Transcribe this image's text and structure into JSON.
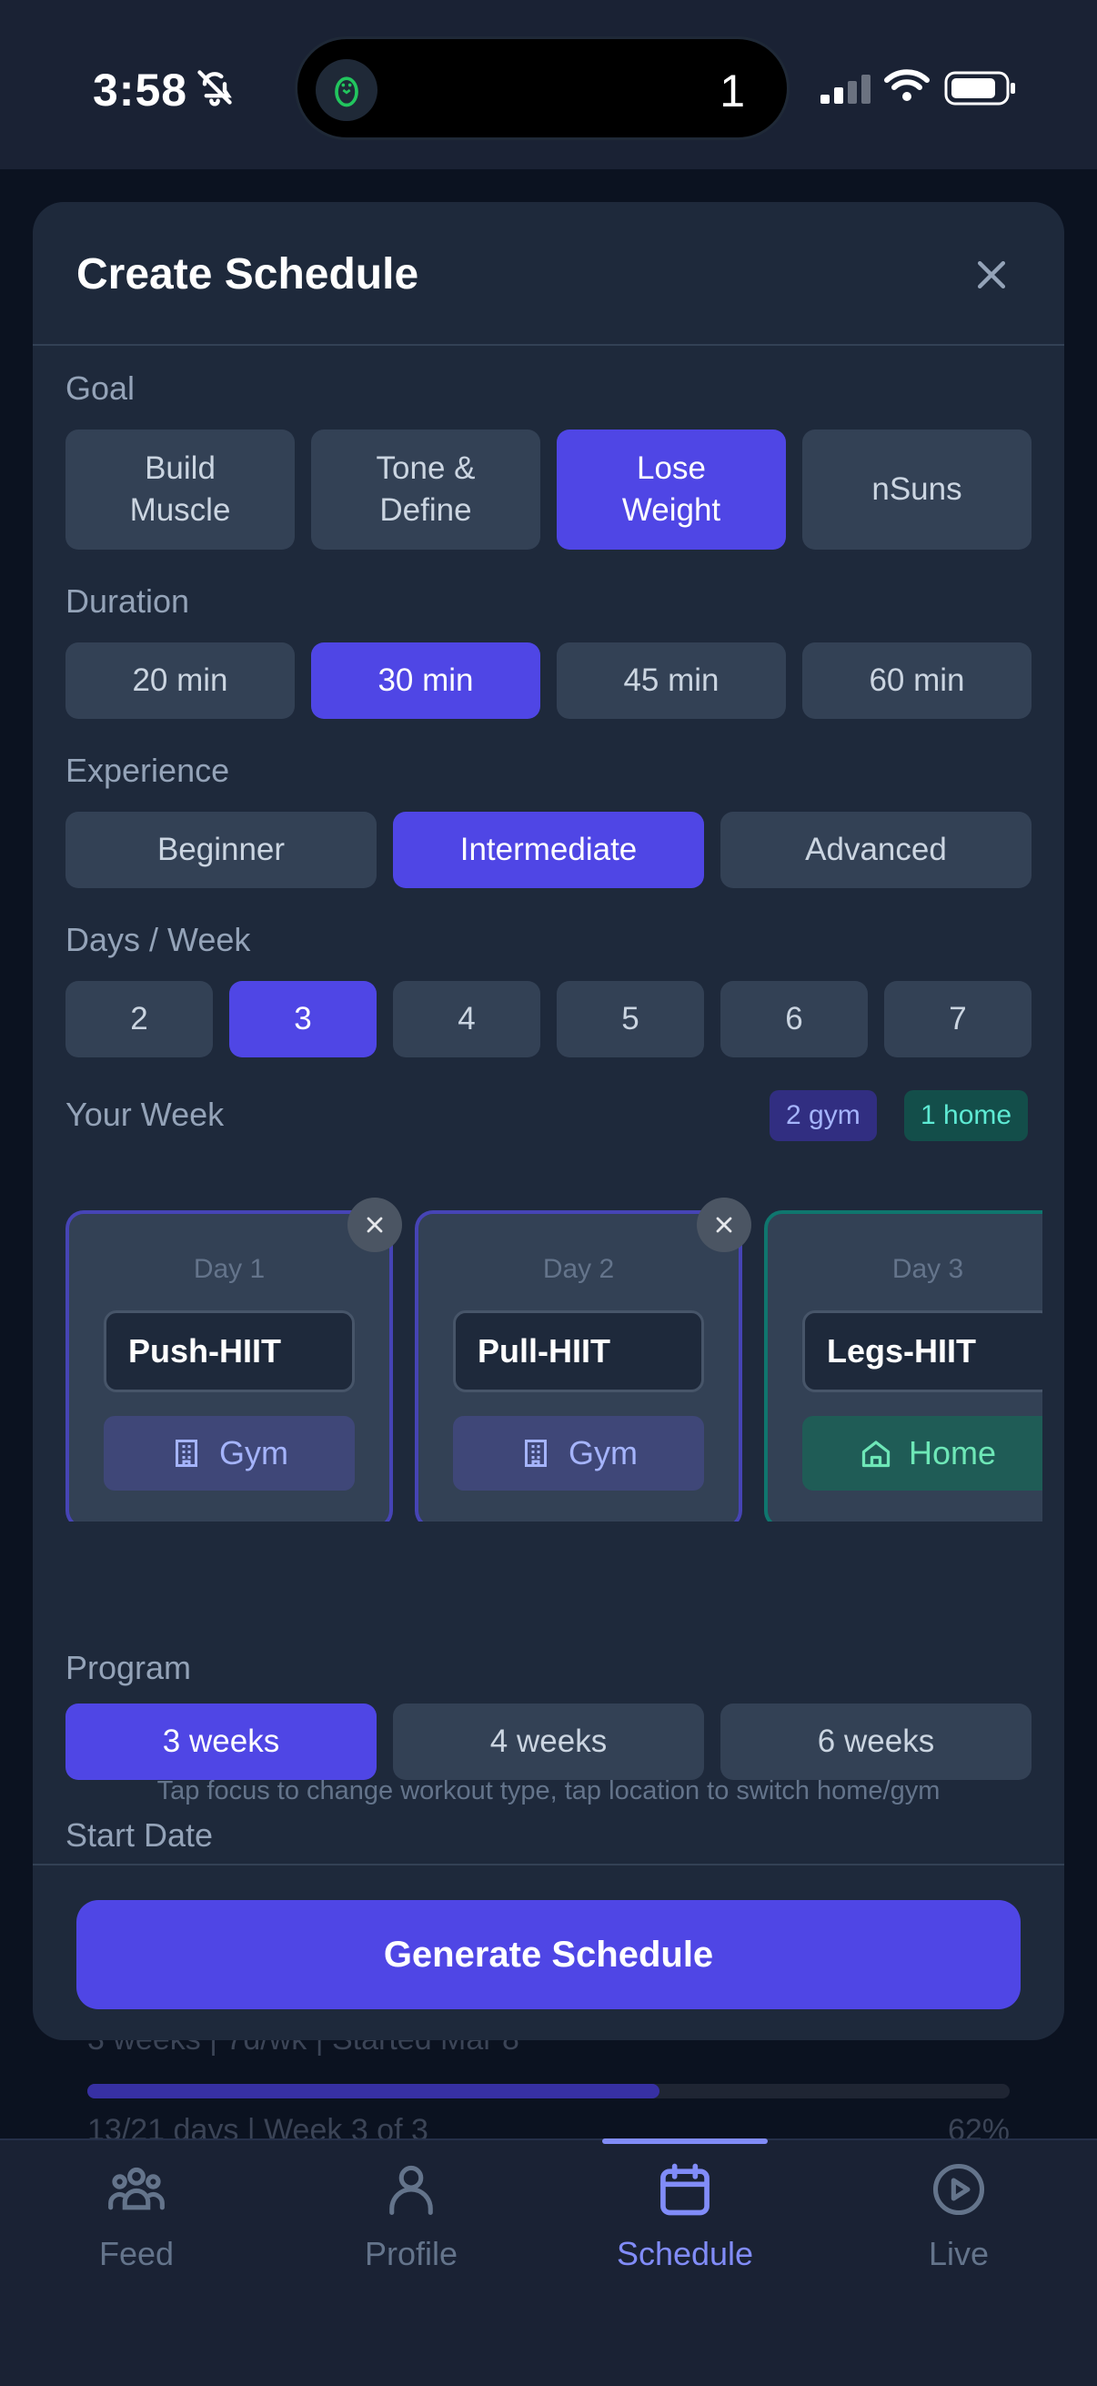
{
  "status_bar": {
    "time": "3:58",
    "island_count": "1"
  },
  "background": {
    "summary": "3 weeks  |  7d/wk  |  Started Mar 8",
    "progress_text": "13/21 days | Week 3 of 3",
    "progress_percent": "62%",
    "progress_value": 0.62
  },
  "modal": {
    "title": "Create Schedule",
    "goal": {
      "label": "Goal",
      "options": [
        "Build\nMuscle",
        "Tone &\nDefine",
        "Lose\nWeight",
        "nSuns"
      ],
      "selected": "Lose Weight"
    },
    "duration": {
      "label": "Duration",
      "options": [
        "20 min",
        "30 min",
        "45 min",
        "60 min"
      ],
      "selected": "30 min"
    },
    "experience": {
      "label": "Experience",
      "options": [
        "Beginner",
        "Intermediate",
        "Advanced"
      ],
      "selected": "Intermediate"
    },
    "days_per_week": {
      "label": "Days / Week",
      "options": [
        "2",
        "3",
        "4",
        "5",
        "6",
        "7"
      ],
      "selected": "3"
    },
    "your_week": {
      "label": "Your Week",
      "gym_tag": "2 gym",
      "home_tag": "1 home",
      "days": [
        {
          "label": "Day 1",
          "focus": "Push-HIIT",
          "location": "Gym"
        },
        {
          "label": "Day 2",
          "focus": "Pull-HIIT",
          "location": "Gym"
        },
        {
          "label": "Day 3",
          "focus": "Legs-HIIT",
          "location": "Home"
        }
      ],
      "hint": "Tap focus to change workout type, tap location to switch home/gym"
    },
    "program": {
      "label": "Program",
      "options": [
        "3 weeks",
        "4 weeks",
        "6 weeks"
      ],
      "selected": "3 weeks"
    },
    "start_date": {
      "label": "Start Date"
    },
    "generate_label": "Generate Schedule"
  },
  "tabbar": {
    "tabs": [
      {
        "label": "Feed",
        "icon": "people-icon"
      },
      {
        "label": "Profile",
        "icon": "person-icon"
      },
      {
        "label": "Schedule",
        "icon": "calendar-icon"
      },
      {
        "label": "Live",
        "icon": "play-circle-icon"
      }
    ],
    "active": "Schedule"
  },
  "colors": {
    "accent": "#4f46e5",
    "home_accent": "#0f766e",
    "modal_bg": "#1e293b",
    "chip_bg": "#334155"
  }
}
